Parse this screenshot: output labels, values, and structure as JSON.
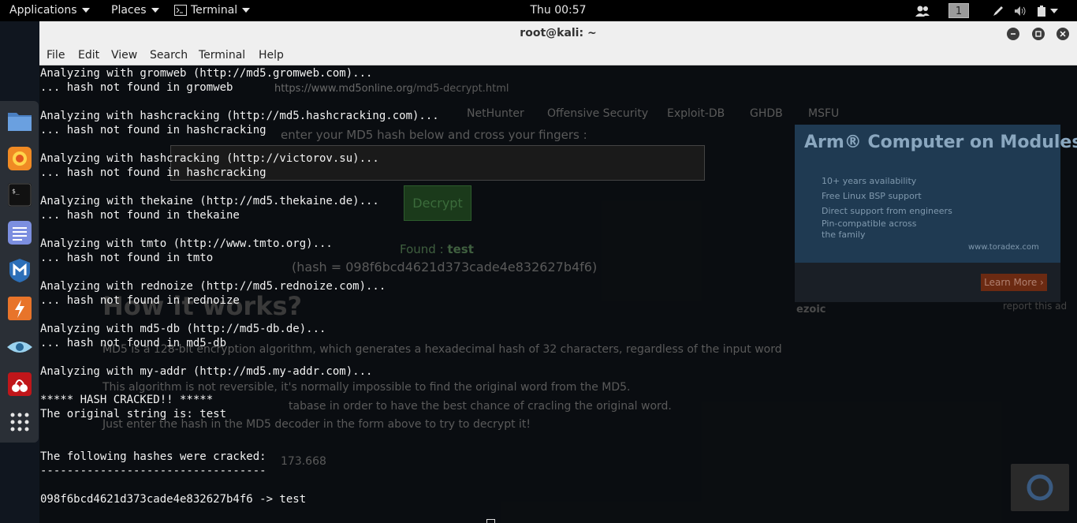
{
  "top_panel": {
    "applications": "Applications",
    "places": "Places",
    "terminal": "Terminal",
    "clock": "Thu 00:57",
    "workspace": "1"
  },
  "dock": {
    "items": [
      "files-icon",
      "firefox-icon",
      "terminal-icon",
      "text-editor-icon",
      "metasploit-icon",
      "burpsuite-icon",
      "eye-icon",
      "cherrytree-icon",
      "show-apps-icon"
    ]
  },
  "window": {
    "title": "root@kali: ~",
    "menu": [
      "File",
      "Edit",
      "View",
      "Search",
      "Terminal",
      "Help"
    ]
  },
  "terminal": {
    "lines": [
      "Analyzing with gromweb (http://md5.gromweb.com)...",
      "... hash not found in gromweb",
      "",
      "Analyzing with hashcracking (http://md5.hashcracking.com)...",
      "... hash not found in hashcracking",
      "",
      "Analyzing with hashcracking (http://victorov.su)...",
      "... hash not found in hashcracking",
      "",
      "Analyzing with thekaine (http://md5.thekaine.de)...",
      "... hash not found in thekaine",
      "",
      "Analyzing with tmto (http://www.tmto.org)...",
      "... hash not found in tmto",
      "",
      "Analyzing with rednoize (http://md5.rednoize.com)...",
      "... hash not found in rednoize",
      "",
      "Analyzing with md5-db (http://md5-db.de)...",
      "... hash not found in md5-db",
      "",
      "Analyzing with my-addr (http://md5.my-addr.com)...",
      "",
      "***** HASH CRACKED!! *****",
      "The original string is: test",
      "",
      "",
      "The following hashes were cracked:",
      "----------------------------------",
      "",
      "098f6bcd4621d373cade4e832627b4f6 -> test"
    ]
  },
  "background_browser": {
    "url_host": "https://www.md5online.org",
    "url_path": "/md5-decrypt.html",
    "bookmarks": [
      "NetHunter",
      "Offensive Security",
      "Exploit-DB",
      "GHDB",
      "MSFU"
    ],
    "prompt": "enter your MD5 hash below and cross your fingers :",
    "decrypt_button": "Decrypt",
    "found_label": "Found :",
    "found_value": "test",
    "hash_line": "(hash = 098f6bcd4621d373cade4e832627b4f6)",
    "heading": "How it works?",
    "para1": "MD5 is a 128-bit encryption algorithm, which generates a hexadecimal hash of 32 characters, regardless of the input word",
    "para2": "This algorithm is not reversible, it's normally impossible to find the original word from the MD5.",
    "para3": "tabase in order to have the best chance of cracling the original word.",
    "para4": "Just enter the hash in the MD5 decoder in the form above to try to decrypt it!",
    "count": "173.668",
    "ad_title": "Arm® Computer on Modules",
    "ad_bullets": [
      "10+ years availability",
      "Free Linux BSP support",
      "Direct support from engineers",
      "Pin-compatible across the family"
    ],
    "ad_url": "www.toradex.com",
    "ad_cta": "Learn More ›",
    "ad_brand": "ezoic",
    "ad_report": "report this ad"
  }
}
